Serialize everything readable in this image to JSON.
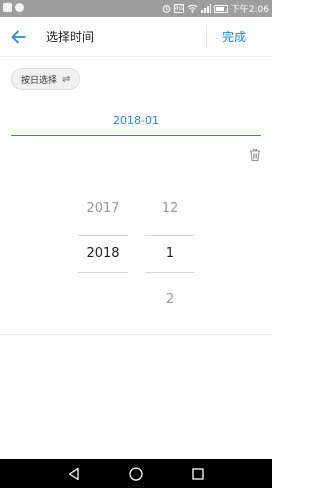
{
  "status_bar": {
    "time": "下午2:06",
    "network_badge": "4G",
    "icons": [
      "app-icon",
      "app-icon",
      "alarm-icon",
      "sim-icon",
      "wifi-icon",
      "signal-icon",
      "battery-icon"
    ]
  },
  "header": {
    "title": "选择时间",
    "done_label": "完成",
    "back_icon": "arrow-left-icon"
  },
  "mode_chip": {
    "label": "按日选择",
    "icon": "swap-icon"
  },
  "selected_value": "2018-01",
  "delete_icon": "trash-icon",
  "picker": {
    "year": {
      "prev": "2017",
      "selected": "2018",
      "next": ""
    },
    "month": {
      "prev": "12",
      "selected": "1",
      "next": "2"
    }
  },
  "colors": {
    "accent": "#1e88e5",
    "status_bar": "#9e9e9e",
    "nav_bar": "#000000"
  }
}
